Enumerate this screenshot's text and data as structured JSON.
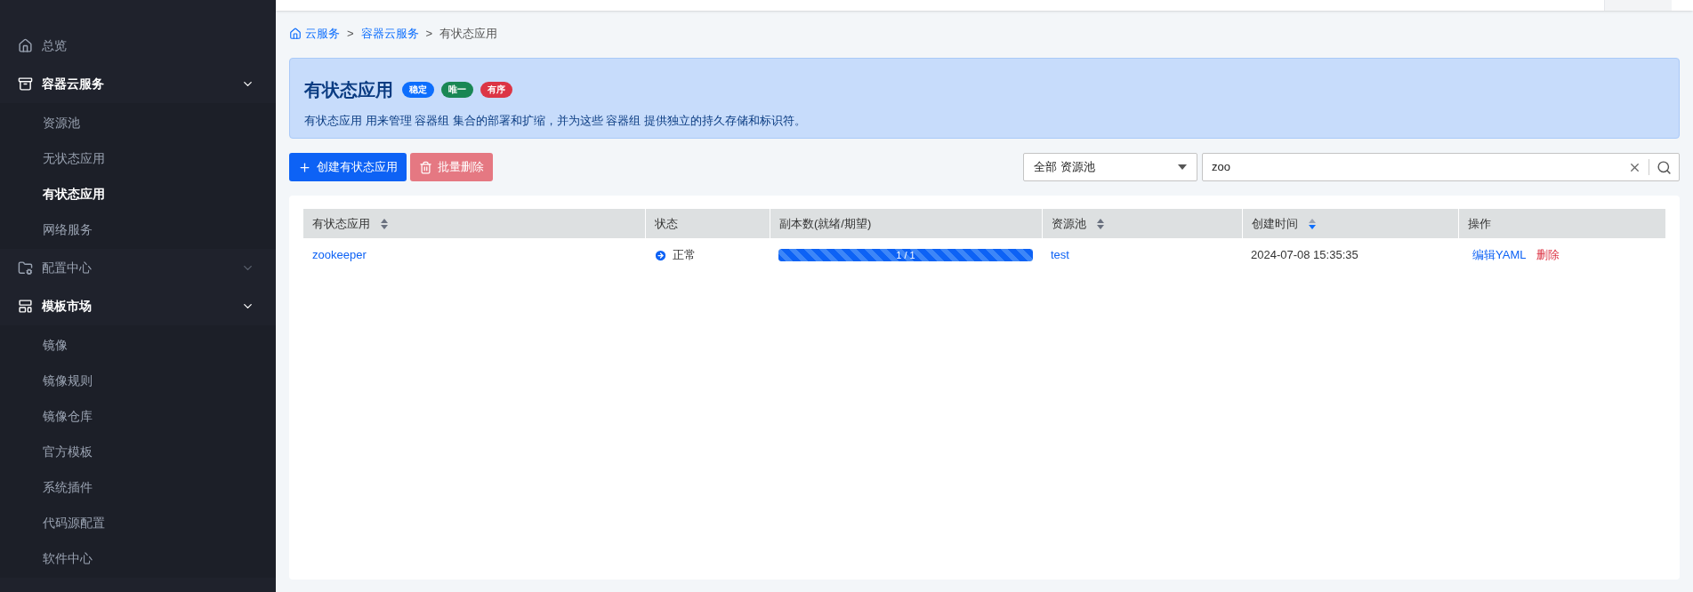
{
  "sidebar": {
    "items": [
      {
        "label": "总览",
        "selected": false
      },
      {
        "label": "容器云服务",
        "selected": false,
        "expanded": true,
        "children": [
          {
            "label": "资源池",
            "selected": false
          },
          {
            "label": "无状态应用",
            "selected": false
          },
          {
            "label": "有状态应用",
            "selected": true
          },
          {
            "label": "网络服务",
            "selected": false
          }
        ]
      },
      {
        "label": "配置中心",
        "selected": false,
        "expanded": false
      },
      {
        "label": "模板市场",
        "selected": false,
        "expanded": true,
        "children": [
          {
            "label": "镜像",
            "selected": false
          },
          {
            "label": "镜像规则",
            "selected": false
          },
          {
            "label": "镜像仓库",
            "selected": false
          },
          {
            "label": "官方模板",
            "selected": false
          },
          {
            "label": "系统插件",
            "selected": false
          },
          {
            "label": "代码源配置",
            "selected": false
          },
          {
            "label": "软件中心",
            "selected": false
          }
        ]
      }
    ]
  },
  "breadcrumb": [
    {
      "label": "云服务",
      "separator": ">"
    },
    {
      "label": "容器云服务",
      "separator": ">"
    },
    {
      "label": "有状态应用"
    }
  ],
  "banner": {
    "title": "有状态应用",
    "badges": [
      {
        "label": "稳定",
        "color": "#0d6efd"
      },
      {
        "label": "唯一",
        "color": "#198754"
      },
      {
        "label": "有序",
        "color": "#dc3545"
      }
    ],
    "description": "有状态应用 用来管理 容器组 集合的部署和扩缩，并为这些 容器组 提供独立的持久存储和标识符。"
  },
  "toolbar": {
    "create_button": "创建有状态应用",
    "delete_button": {
      "label": "批量删除",
      "disabled": true
    },
    "pool_select": "全部 资源池",
    "search": {
      "value": "zoo"
    }
  },
  "table": {
    "columns": [
      {
        "label": "有状态应用",
        "sortable": true,
        "sorted": false
      },
      {
        "label": "状态"
      },
      {
        "label": "副本数(就绪/期望)"
      },
      {
        "label": "资源池",
        "sortable": true,
        "sorted": false
      },
      {
        "label": "创建时间",
        "sortable": true,
        "sorted": true
      },
      {
        "label": "操作"
      }
    ],
    "rows": [
      {
        "name": "zookeeper",
        "status": "正常",
        "replicas": {
          "text": "1 / 1",
          "level": 1
        },
        "pool": "test",
        "created": "2024-07-08 15:35:35",
        "actions": [
          {
            "label": "编辑YAML",
            "kind": "edit"
          },
          {
            "label": "删除",
            "kind": "delete"
          }
        ]
      }
    ]
  }
}
